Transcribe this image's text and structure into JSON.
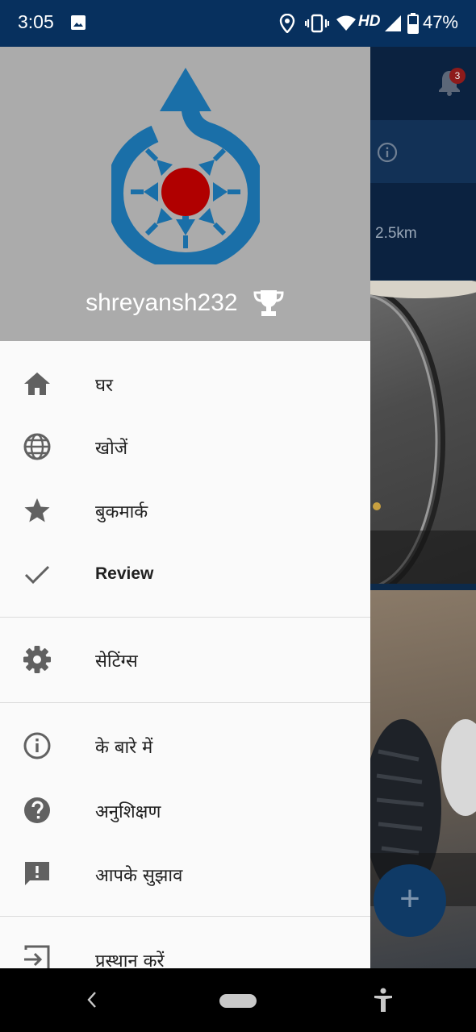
{
  "status_bar": {
    "time": "3:05",
    "network": "HD",
    "battery": "47%",
    "icons": [
      "image-icon",
      "location-icon",
      "vibrate-icon",
      "wifi-icon",
      "signal-icon",
      "battery-icon"
    ]
  },
  "background": {
    "distance": "2.5km",
    "notification_count": "3"
  },
  "drawer": {
    "username": "shreyansh232",
    "items": [
      {
        "label": "घर",
        "icon": "home-icon"
      },
      {
        "label": "खोजें",
        "icon": "globe-icon"
      },
      {
        "label": "बुकमार्क",
        "icon": "star-icon"
      },
      {
        "label": "Review",
        "icon": "check-icon"
      },
      {
        "label": "सेटिंग्स",
        "icon": "gear-icon"
      },
      {
        "label": "के बारे में",
        "icon": "info-icon"
      },
      {
        "label": "अनुशिक्षण",
        "icon": "help-icon"
      },
      {
        "label": "आपके सुझाव",
        "icon": "feedback-icon"
      },
      {
        "label": "प्रस्थान करें",
        "icon": "logout-icon"
      }
    ]
  },
  "colors": {
    "status_bar": "#07305e",
    "drawer_header": "#ababab",
    "icon_grey": "#616161",
    "logo_blue": "#1a6fa8",
    "logo_red": "#b00000"
  }
}
